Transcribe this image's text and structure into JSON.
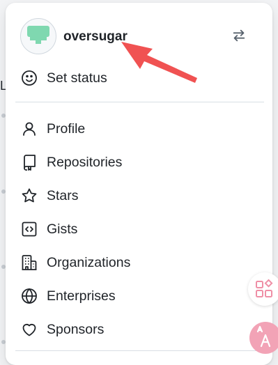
{
  "user": {
    "username": "oversugar"
  },
  "menu": {
    "set_status": "Set status",
    "items": [
      {
        "label": "Profile",
        "icon": "person-icon"
      },
      {
        "label": "Repositories",
        "icon": "repo-icon"
      },
      {
        "label": "Stars",
        "icon": "star-icon"
      },
      {
        "label": "Gists",
        "icon": "code-square-icon"
      },
      {
        "label": "Organizations",
        "icon": "organization-icon"
      },
      {
        "label": "Enterprises",
        "icon": "globe-icon"
      },
      {
        "label": "Sponsors",
        "icon": "heart-icon"
      }
    ]
  },
  "background": {
    "edge_letter": "L"
  },
  "colors": {
    "annotation_arrow": "#f05252",
    "avatar": "#7fd8b0"
  }
}
